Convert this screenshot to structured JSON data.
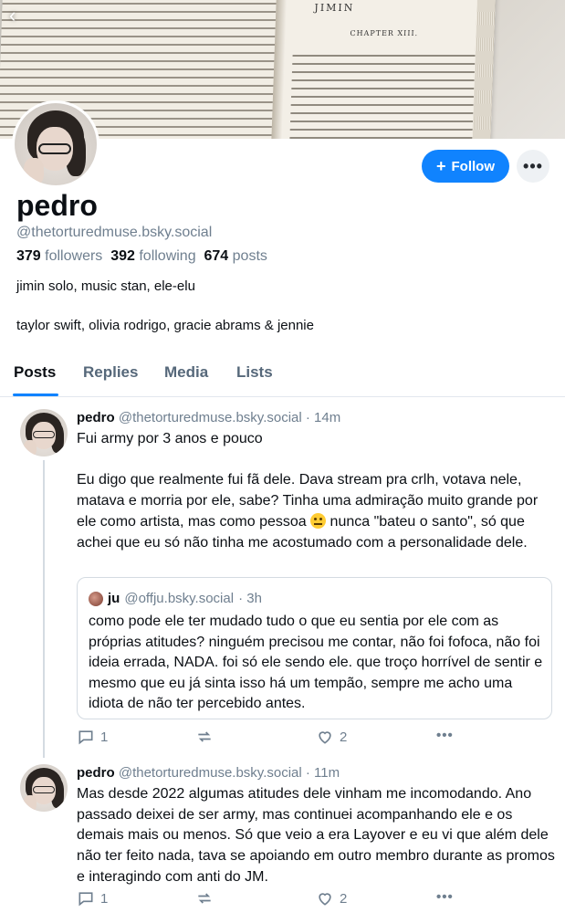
{
  "banner": {
    "chapter_title": "JIMIN",
    "chapter_sub": "CHAPTER XIII."
  },
  "header": {
    "follow_label": "Follow",
    "more_label": "•••"
  },
  "profile": {
    "display_name": "pedro",
    "handle": "@thetorturedmuse.bsky.social",
    "followers_count": "379",
    "followers_label": "followers",
    "following_count": "392",
    "following_label": "following",
    "posts_count": "674",
    "posts_label": "posts",
    "bio_line1": "jimin solo, music stan, ele-elu",
    "bio_line2": "taylor swift, olivia rodrigo, gracie abrams & jennie"
  },
  "tabs": [
    {
      "label": "Posts",
      "active": true
    },
    {
      "label": "Replies",
      "active": false
    },
    {
      "label": "Media",
      "active": false
    },
    {
      "label": "Lists",
      "active": false
    }
  ],
  "posts": [
    {
      "author": "pedro",
      "handle": "@thetorturedmuse.bsky.social",
      "time": "· 14m",
      "para1": "Fui army por 3 anos e pouco",
      "para2_a": "Eu digo que realmente fui fã dele. Dava stream pra crlh, votava nele, matava e morria por ele, sabe? Tinha uma admiração muito grande por ele como artista, mas como pessoa ",
      "emoji": "neutral-face-emoji",
      "para2_b": " nunca \"bateu o santo\", só que achei que eu só não tinha me acostumado com a personalidade dele.",
      "quote": {
        "author": "ju",
        "handle": "@offju.bsky.social",
        "time": "· 3h",
        "text": "como pode ele ter mudado tudo o que eu sentia por ele com as próprias atitudes? ninguém precisou me contar, não foi fofoca, não foi ideia errada, NADA. foi só ele sendo ele. que troço horrível de sentir e mesmo que eu já sinta isso há um tempão, sempre me acho uma idiota de não ter percebido antes."
      },
      "replies": "1",
      "reposts": "",
      "likes": "2"
    },
    {
      "author": "pedro",
      "handle": "@thetorturedmuse.bsky.social",
      "time": "· 11m",
      "text": "Mas desde 2022 algumas atitudes dele vinham me incomodando. Ano passado deixei de ser army, mas continuei acompanhando ele e os demais mais ou menos. Só que veio a era Layover e eu vi que além dele não ter feito nada, tava se apoiando em outro membro durante as promos e interagindo com anti do JM.",
      "replies": "1",
      "reposts": "",
      "likes": "2"
    }
  ],
  "colors": {
    "accent": "#1083fe",
    "muted_text": "#6f7f8f",
    "border": "#d4dbe2"
  }
}
